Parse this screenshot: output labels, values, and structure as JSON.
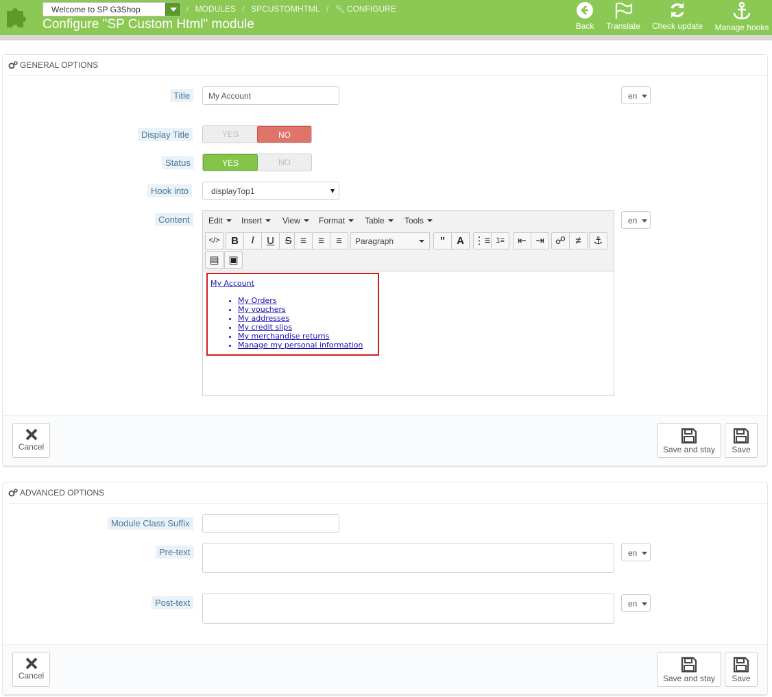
{
  "header": {
    "shop_selector": "Welcome to SP G3Shop",
    "breadcrumb": [
      "MODULES",
      "SPCUSTOMHTML",
      "CONFIGURE"
    ],
    "title": "Configure \"SP Custom Html\" module",
    "toolbar": {
      "back": "Back",
      "translate": "Translate",
      "check_update": "Check update",
      "manage_hooks": "Manage hooks"
    }
  },
  "general": {
    "heading": "GENERAL OPTIONS",
    "title_label": "Title",
    "title_value": "My Account",
    "lang": "en",
    "display_title_label": "Display Title",
    "display_title": {
      "yes": "YES",
      "no": "NO",
      "selected": "NO"
    },
    "status_label": "Status",
    "status": {
      "yes": "YES",
      "no": "NO",
      "selected": "YES"
    },
    "hook_label": "Hook into",
    "hook_value": "displayTop1",
    "content_label": "Content",
    "editor": {
      "menus": [
        "Edit",
        "Insert",
        "View",
        "Format",
        "Table",
        "Tools"
      ],
      "block_format": "Paragraph",
      "content_heading": "My Account",
      "content_links": [
        "My Orders",
        "My vouchers",
        "My addresses",
        "My credit slips",
        "My merchandise returns",
        "Manage my personal information"
      ]
    },
    "cancel": "Cancel",
    "save_and_stay": "Save and stay",
    "save": "Save"
  },
  "advanced": {
    "heading": "ADVANCED OPTIONS",
    "suffix_label": "Module Class Suffix",
    "suffix_value": "",
    "pretext_label": "Pre-text",
    "posttext_label": "Post-text",
    "lang": "en",
    "cancel": "Cancel",
    "save_and_stay": "Save and stay",
    "save": "Save"
  }
}
